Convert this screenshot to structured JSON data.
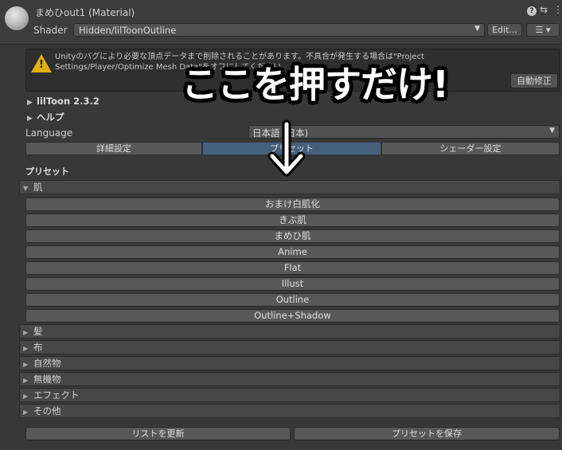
{
  "header": {
    "title": "まめひout1 (Material)",
    "shader_label": "Shader",
    "shader_value": "Hidden/lilToonOutline",
    "edit_label": "Edit...",
    "help_glyph": "?",
    "sliders_glyph": "⇆",
    "more_glyph": "⋮",
    "list_glyph": "☰ ▾",
    "dropdown_arrow": "▼"
  },
  "warning": {
    "text": "Unityのバグにより必要な頂点データまで削除されることがあります。不具合が発生する場合は\"Project Settings/Player/Optimize Mesh Data\"をオフにしてください。",
    "auto_fix_label": "自動修正",
    "icon_glyph": "!"
  },
  "foldouts": {
    "liltoon_label": "lilToon 2.3.2",
    "help_label": "ヘルプ",
    "arrow": "▶"
  },
  "language": {
    "label": "Language",
    "value": "日本語 (日本)"
  },
  "tabs": [
    {
      "label": "詳細設定",
      "selected": false
    },
    {
      "label": "プリセット",
      "selected": true
    },
    {
      "label": "シェーダー設定",
      "selected": false
    }
  ],
  "presets": {
    "heading": "プリセット",
    "open_category": "肌",
    "open_arrow": "▼",
    "closed_arrow": "▶",
    "buttons": [
      "おまけ白肌化",
      "きぶ肌",
      "まめひ肌",
      "Anime",
      "Flat",
      "Illust",
      "Outline",
      "Outline+Shadow"
    ],
    "categories": [
      "髪",
      "布",
      "自然物",
      "無機物",
      "エフェクト",
      "その他"
    ]
  },
  "bottom": {
    "refresh_label": "リストを更新",
    "save_label": "プリセットを保存"
  },
  "annotation": {
    "text": "ここを押すだけ!"
  },
  "colors": {
    "background": "#383838",
    "selected_tab": "#46607c",
    "warning_icon": "#e3ad14",
    "annotation": "#ffffff"
  }
}
